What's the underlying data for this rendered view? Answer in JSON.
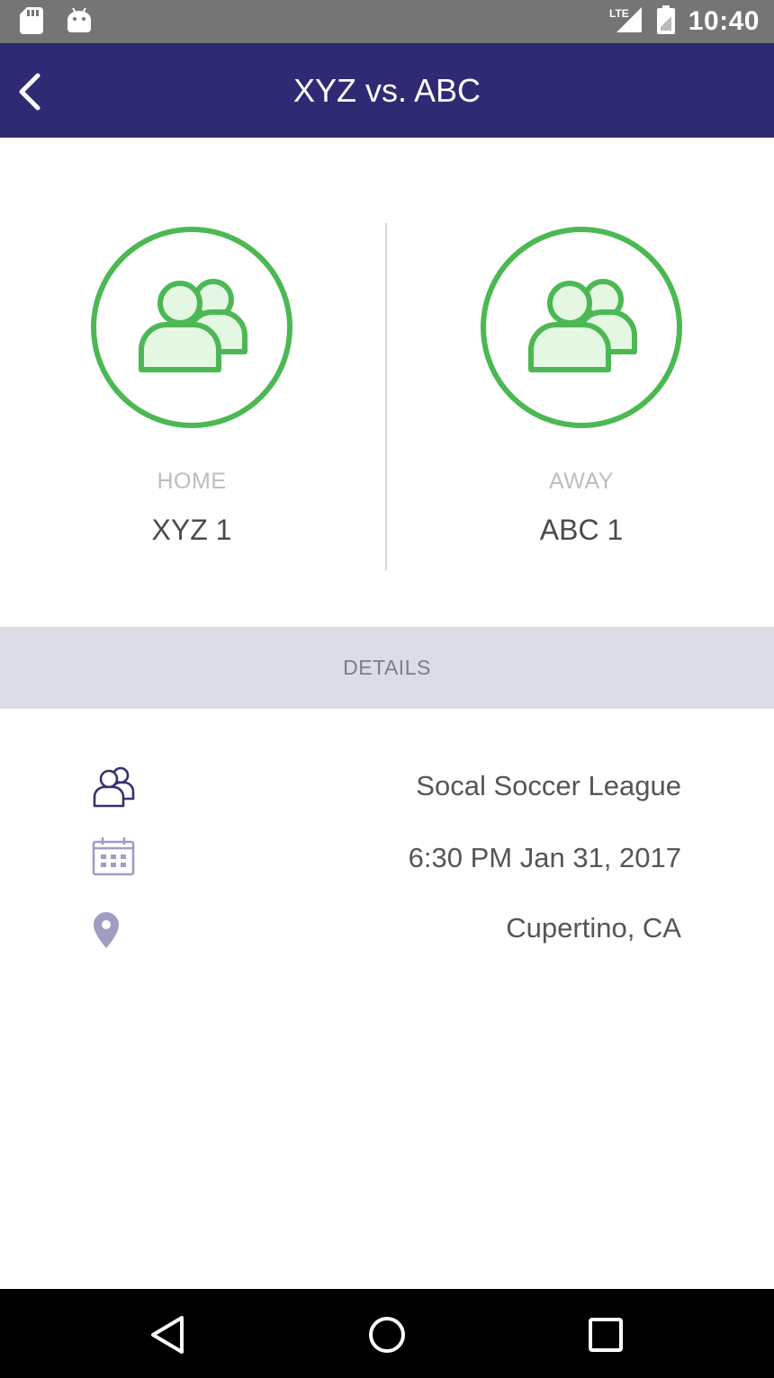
{
  "status_bar": {
    "time": "10:40",
    "network": "LTE",
    "icons": [
      "sd-card-icon",
      "android-icon",
      "lte-signal-icon",
      "battery-icon"
    ]
  },
  "app_bar": {
    "title": "XYZ vs. ABC",
    "back_icon": "chevron-left-icon"
  },
  "match": {
    "home": {
      "label": "HOME",
      "name": "XYZ 1",
      "icon": "team-group-icon"
    },
    "away": {
      "label": "AWAY",
      "name": "ABC 1",
      "icon": "team-group-icon"
    }
  },
  "details": {
    "header": "DETAILS",
    "league": {
      "icon": "users-icon",
      "value": "Socal Soccer League"
    },
    "datetime": {
      "icon": "calendar-icon",
      "value": "6:30 PM Jan 31, 2017"
    },
    "location": {
      "icon": "map-pin-icon",
      "value": "Cupertino, CA"
    }
  },
  "nav_bar": {
    "buttons": [
      "back-triangle-icon",
      "home-circle-icon",
      "recents-square-icon"
    ]
  },
  "colors": {
    "app_bar": "#2e2a73",
    "accent_green": "#4cb854",
    "green_fill": "#e3f7e3",
    "icon_purple": "#35306f",
    "icon_lavender": "#a09dc2",
    "details_header_bg": "#dcdce6",
    "status_bar": "#757575"
  }
}
